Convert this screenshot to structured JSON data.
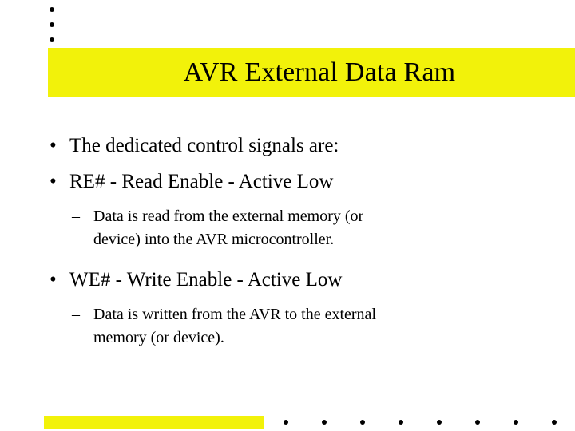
{
  "slide": {
    "title": "AVR External Data Ram",
    "title_banner_color": "#f2f20a",
    "background_color": "#ffffff",
    "text_color": "#000000"
  },
  "decor": {
    "top_dots": {
      "icon": "bullet-dot-icon",
      "count": 3,
      "color": "#000000"
    },
    "bottom_bar": {
      "color": "#f2f20a"
    },
    "bottom_dots": {
      "icon": "bullet-dot-icon",
      "count": 8,
      "color": "#000000"
    }
  },
  "content": {
    "bullet_marker": "•",
    "sub_bullet_marker": "–",
    "items": [
      {
        "level": 1,
        "text": "The dedicated control signals are:"
      },
      {
        "level": 1,
        "text": "RE# - Read Enable - Active Low"
      },
      {
        "level": 2,
        "line1": "Data is read from the external memory (or",
        "line2": "device) into the AVR microcontroller."
      },
      {
        "level": 1,
        "text": "WE# - Write Enable - Active Low"
      },
      {
        "level": 2,
        "line1": "Data is written from the AVR to the external",
        "line2": "memory (or device)."
      }
    ]
  }
}
